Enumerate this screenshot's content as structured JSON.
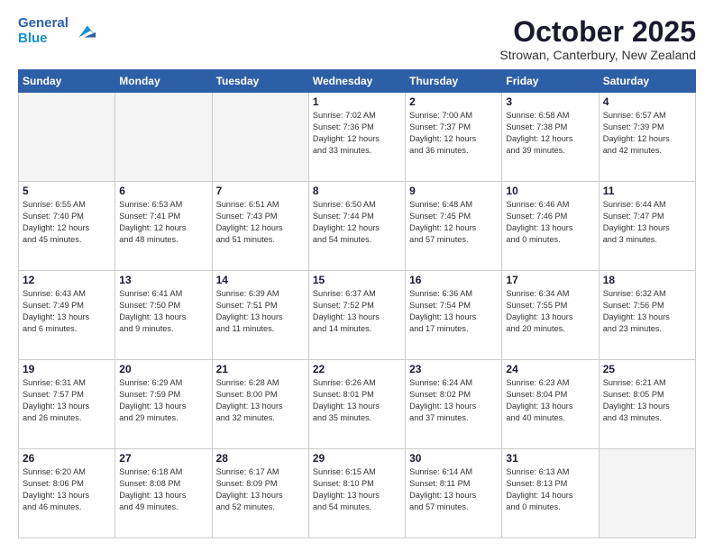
{
  "header": {
    "logo_line1": "General",
    "logo_line2": "Blue",
    "month_title": "October 2025",
    "location": "Strowan, Canterbury, New Zealand"
  },
  "days_of_week": [
    "Sunday",
    "Monday",
    "Tuesday",
    "Wednesday",
    "Thursday",
    "Friday",
    "Saturday"
  ],
  "weeks": [
    [
      {
        "day": "",
        "info": ""
      },
      {
        "day": "",
        "info": ""
      },
      {
        "day": "",
        "info": ""
      },
      {
        "day": "1",
        "info": "Sunrise: 7:02 AM\nSunset: 7:36 PM\nDaylight: 12 hours\nand 33 minutes."
      },
      {
        "day": "2",
        "info": "Sunrise: 7:00 AM\nSunset: 7:37 PM\nDaylight: 12 hours\nand 36 minutes."
      },
      {
        "day": "3",
        "info": "Sunrise: 6:58 AM\nSunset: 7:38 PM\nDaylight: 12 hours\nand 39 minutes."
      },
      {
        "day": "4",
        "info": "Sunrise: 6:57 AM\nSunset: 7:39 PM\nDaylight: 12 hours\nand 42 minutes."
      }
    ],
    [
      {
        "day": "5",
        "info": "Sunrise: 6:55 AM\nSunset: 7:40 PM\nDaylight: 12 hours\nand 45 minutes."
      },
      {
        "day": "6",
        "info": "Sunrise: 6:53 AM\nSunset: 7:41 PM\nDaylight: 12 hours\nand 48 minutes."
      },
      {
        "day": "7",
        "info": "Sunrise: 6:51 AM\nSunset: 7:43 PM\nDaylight: 12 hours\nand 51 minutes."
      },
      {
        "day": "8",
        "info": "Sunrise: 6:50 AM\nSunset: 7:44 PM\nDaylight: 12 hours\nand 54 minutes."
      },
      {
        "day": "9",
        "info": "Sunrise: 6:48 AM\nSunset: 7:45 PM\nDaylight: 12 hours\nand 57 minutes."
      },
      {
        "day": "10",
        "info": "Sunrise: 6:46 AM\nSunset: 7:46 PM\nDaylight: 13 hours\nand 0 minutes."
      },
      {
        "day": "11",
        "info": "Sunrise: 6:44 AM\nSunset: 7:47 PM\nDaylight: 13 hours\nand 3 minutes."
      }
    ],
    [
      {
        "day": "12",
        "info": "Sunrise: 6:43 AM\nSunset: 7:49 PM\nDaylight: 13 hours\nand 6 minutes."
      },
      {
        "day": "13",
        "info": "Sunrise: 6:41 AM\nSunset: 7:50 PM\nDaylight: 13 hours\nand 9 minutes."
      },
      {
        "day": "14",
        "info": "Sunrise: 6:39 AM\nSunset: 7:51 PM\nDaylight: 13 hours\nand 11 minutes."
      },
      {
        "day": "15",
        "info": "Sunrise: 6:37 AM\nSunset: 7:52 PM\nDaylight: 13 hours\nand 14 minutes."
      },
      {
        "day": "16",
        "info": "Sunrise: 6:36 AM\nSunset: 7:54 PM\nDaylight: 13 hours\nand 17 minutes."
      },
      {
        "day": "17",
        "info": "Sunrise: 6:34 AM\nSunset: 7:55 PM\nDaylight: 13 hours\nand 20 minutes."
      },
      {
        "day": "18",
        "info": "Sunrise: 6:32 AM\nSunset: 7:56 PM\nDaylight: 13 hours\nand 23 minutes."
      }
    ],
    [
      {
        "day": "19",
        "info": "Sunrise: 6:31 AM\nSunset: 7:57 PM\nDaylight: 13 hours\nand 26 minutes."
      },
      {
        "day": "20",
        "info": "Sunrise: 6:29 AM\nSunset: 7:59 PM\nDaylight: 13 hours\nand 29 minutes."
      },
      {
        "day": "21",
        "info": "Sunrise: 6:28 AM\nSunset: 8:00 PM\nDaylight: 13 hours\nand 32 minutes."
      },
      {
        "day": "22",
        "info": "Sunrise: 6:26 AM\nSunset: 8:01 PM\nDaylight: 13 hours\nand 35 minutes."
      },
      {
        "day": "23",
        "info": "Sunrise: 6:24 AM\nSunset: 8:02 PM\nDaylight: 13 hours\nand 37 minutes."
      },
      {
        "day": "24",
        "info": "Sunrise: 6:23 AM\nSunset: 8:04 PM\nDaylight: 13 hours\nand 40 minutes."
      },
      {
        "day": "25",
        "info": "Sunrise: 6:21 AM\nSunset: 8:05 PM\nDaylight: 13 hours\nand 43 minutes."
      }
    ],
    [
      {
        "day": "26",
        "info": "Sunrise: 6:20 AM\nSunset: 8:06 PM\nDaylight: 13 hours\nand 46 minutes."
      },
      {
        "day": "27",
        "info": "Sunrise: 6:18 AM\nSunset: 8:08 PM\nDaylight: 13 hours\nand 49 minutes."
      },
      {
        "day": "28",
        "info": "Sunrise: 6:17 AM\nSunset: 8:09 PM\nDaylight: 13 hours\nand 52 minutes."
      },
      {
        "day": "29",
        "info": "Sunrise: 6:15 AM\nSunset: 8:10 PM\nDaylight: 13 hours\nand 54 minutes."
      },
      {
        "day": "30",
        "info": "Sunrise: 6:14 AM\nSunset: 8:11 PM\nDaylight: 13 hours\nand 57 minutes."
      },
      {
        "day": "31",
        "info": "Sunrise: 6:13 AM\nSunset: 8:13 PM\nDaylight: 14 hours\nand 0 minutes."
      },
      {
        "day": "",
        "info": ""
      }
    ]
  ]
}
